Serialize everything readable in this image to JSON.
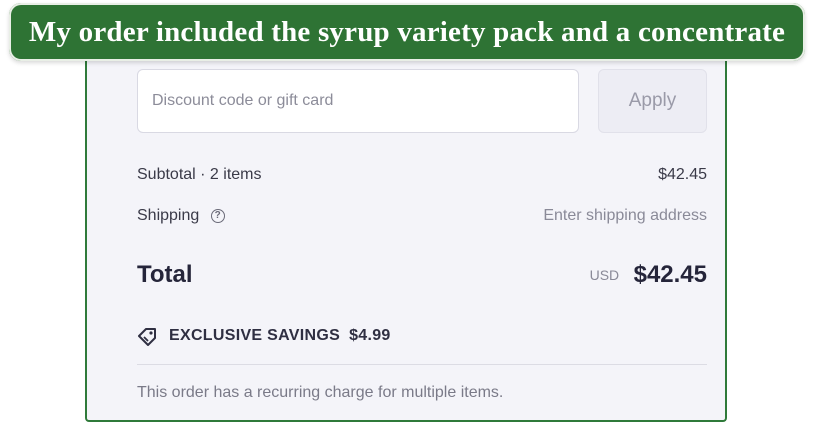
{
  "banner": {
    "text": "My order included the syrup variety pack and a concentrate"
  },
  "discount": {
    "placeholder": "Discount code or gift card",
    "apply_label": "Apply"
  },
  "summary": {
    "subtotal_label": "Subtotal · 2 items",
    "subtotal_value": "$42.45",
    "shipping_label": "Shipping",
    "shipping_value": "Enter shipping address",
    "total_label": "Total",
    "currency": "USD",
    "total_value": "$42.45"
  },
  "savings": {
    "label": "EXCLUSIVE SAVINGS",
    "amount": "$4.99"
  },
  "note": "This order has a recurring charge for multiple items.",
  "icons": {
    "help": "question-circle-icon",
    "tag": "tag-icon"
  },
  "colors": {
    "banner_bg": "#2e7334",
    "panel_border": "#2f7a3a",
    "panel_bg": "#f4f4f9"
  }
}
